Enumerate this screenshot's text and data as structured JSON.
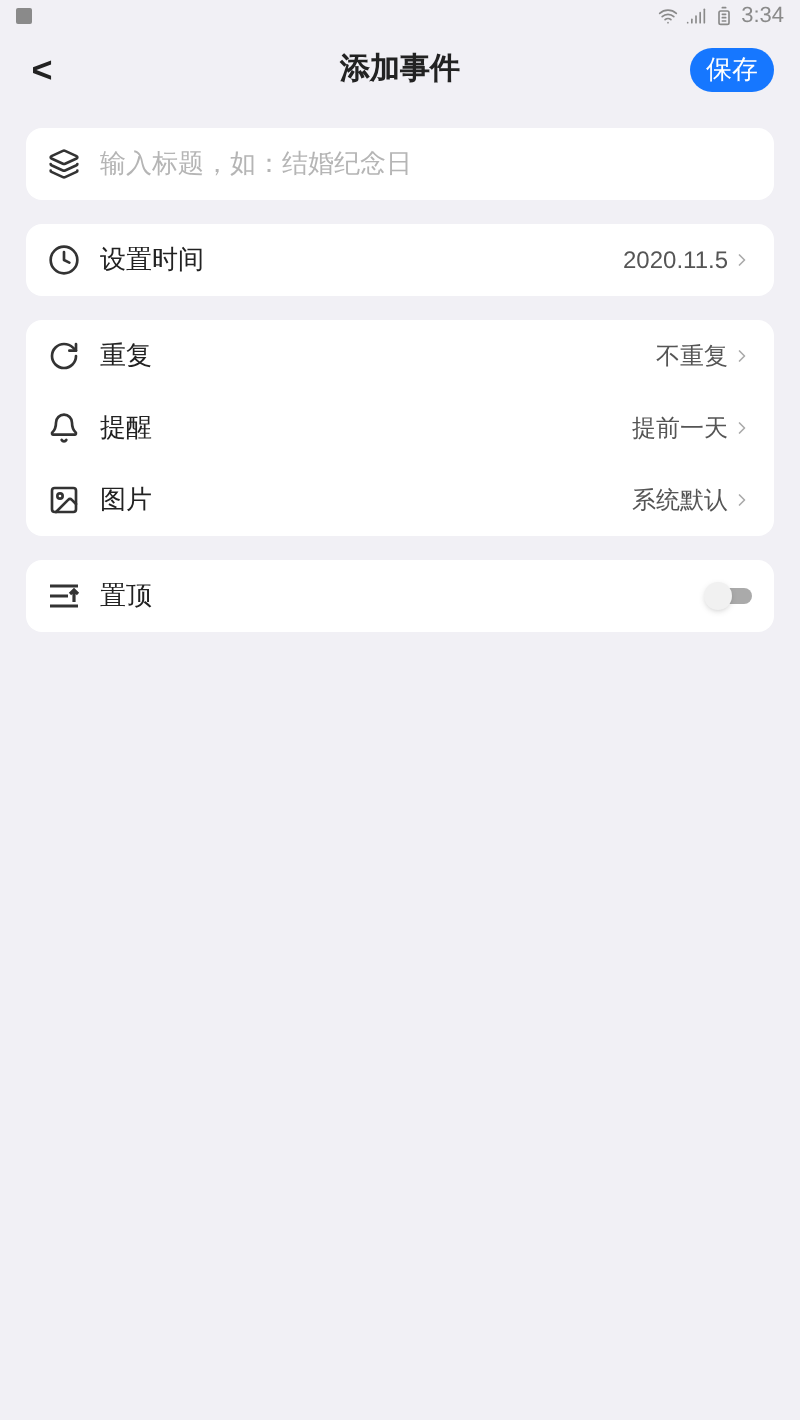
{
  "status_bar": {
    "time": "3:34"
  },
  "header": {
    "back": "<",
    "title": "添加事件",
    "save": "保存"
  },
  "title_field": {
    "placeholder": "输入标题，如：结婚纪念日"
  },
  "groups": [
    {
      "rows": [
        {
          "kind": "clock",
          "label": "设置时间",
          "value": "2020.11.5"
        }
      ]
    },
    {
      "rows": [
        {
          "kind": "repeat",
          "label": "重复",
          "value": "不重复"
        },
        {
          "kind": "bell",
          "label": "提醒",
          "value": "提前一天"
        },
        {
          "kind": "image",
          "label": "图片",
          "value": "系统默认"
        }
      ]
    },
    {
      "rows": [
        {
          "kind": "pin",
          "label": "置顶",
          "on": false
        }
      ]
    }
  ]
}
